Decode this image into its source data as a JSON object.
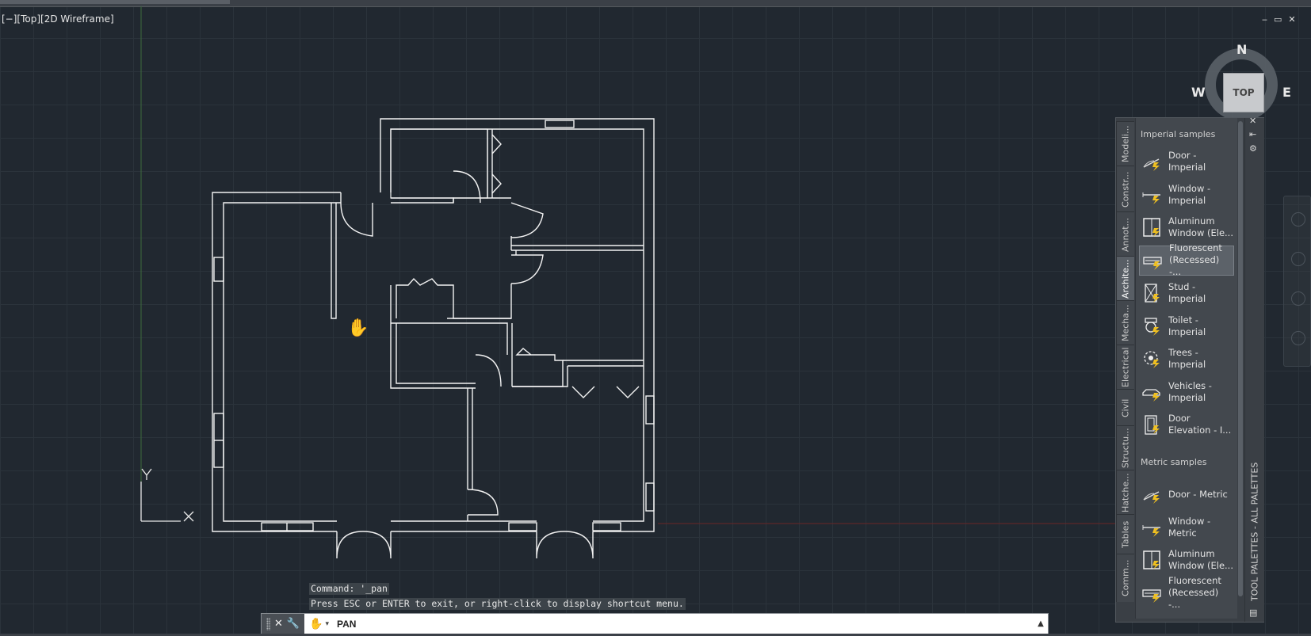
{
  "viewport": {
    "label": "[−][Top][2D Wireframe]",
    "window_controls": [
      "‒",
      "▭",
      "✕"
    ],
    "ucs": {
      "x_label": "X",
      "y_label": "Y"
    },
    "background_color": "#212830",
    "grid_color": "#2b333b"
  },
  "viewcube": {
    "face": "TOP",
    "north": "N",
    "west": "W",
    "east": "E"
  },
  "palette": {
    "tabs": [
      {
        "label": "Modeli..."
      },
      {
        "label": "Constr..."
      },
      {
        "label": "Annot..."
      },
      {
        "label": "Archite...",
        "active": true
      },
      {
        "label": "Mecha..."
      },
      {
        "label": "Electrical"
      },
      {
        "label": "Civil"
      },
      {
        "label": "Structu..."
      },
      {
        "label": "Hatche..."
      },
      {
        "label": "Tables"
      },
      {
        "label": "Comm..."
      }
    ],
    "imperial_title": "Imperial samples",
    "imperial_items": [
      {
        "label": "Door - Imperial",
        "icon": "door-icon"
      },
      {
        "label": "Window - Imperial",
        "icon": "window-icon"
      },
      {
        "label": "Aluminum Window (Ele...",
        "icon": "aluminum-window-icon"
      },
      {
        "label": "Fluorescent (Recessed) -...",
        "icon": "fluorescent-icon",
        "highlighted": true
      },
      {
        "label": "Stud - Imperial",
        "icon": "stud-icon"
      },
      {
        "label": "Toilet - Imperial",
        "icon": "toilet-icon"
      },
      {
        "label": "Trees - Imperial",
        "icon": "tree-icon"
      },
      {
        "label": "Vehicles - Imperial",
        "icon": "vehicle-icon"
      },
      {
        "label": "Door Elevation - I...",
        "icon": "door-elevation-icon"
      }
    ],
    "metric_title": "Metric samples",
    "metric_items": [
      {
        "label": "Door - Metric",
        "icon": "door-icon"
      },
      {
        "label": "Window - Metric",
        "icon": "window-icon"
      },
      {
        "label": "Aluminum Window (Ele...",
        "icon": "aluminum-window-icon"
      },
      {
        "label": "Fluorescent (Recessed) -...",
        "icon": "fluorescent-icon"
      }
    ],
    "side_title": "TOOL PALETTES - ALL PALETTES",
    "controls": {
      "close": "✕",
      "autohide": "⇤",
      "properties": "⚙"
    }
  },
  "command": {
    "history": [
      "Command: '_pan",
      "Press ESC or ENTER to exit, or right-click to display shortcut menu."
    ],
    "current": "PAN",
    "arrow": "▲"
  }
}
